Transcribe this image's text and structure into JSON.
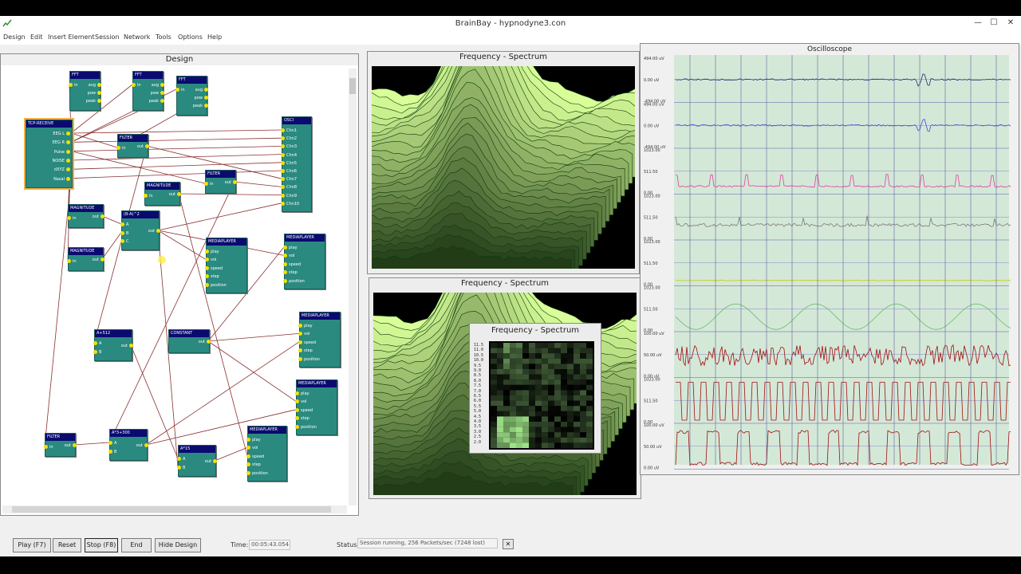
{
  "window": {
    "title": "BrainBay - hypnodyne3.con",
    "minimize": "—",
    "maximize": "☐",
    "close": "✕"
  },
  "menu": [
    "Design",
    "Edit",
    "Insert Element",
    "Session",
    "Network",
    "Tools",
    "Options",
    "Help"
  ],
  "design": {
    "title": "Design",
    "nodes": [
      {
        "id": "fft1",
        "title": "FFT",
        "ports": [
          "in",
          "avg",
          "pow",
          "peak"
        ]
      },
      {
        "id": "fft2",
        "title": "FFT",
        "ports": [
          "in",
          "avg",
          "pow",
          "peak"
        ]
      },
      {
        "id": "fft3",
        "title": "FFT",
        "ports": [
          "in",
          "avg",
          "pow",
          "peak"
        ]
      },
      {
        "id": "tcp",
        "title": "TCP-RECEIVE",
        "ports": [
          "EEG L",
          "EEG R",
          "Pulse",
          "NOISE",
          "dXYZ",
          "Nasal"
        ]
      },
      {
        "id": "filter1",
        "title": "FILTER",
        "ports": [
          "in",
          "out"
        ]
      },
      {
        "id": "osci",
        "title": "OSCI",
        "ports": [
          "Chn1",
          "Chn2",
          "Chn3",
          "Chn4",
          "Chn5",
          "Chn6",
          "Chn7",
          "Chn8",
          "Chn9",
          "Chn10"
        ]
      },
      {
        "id": "mag1",
        "title": "MAGNITUDE",
        "ports": [
          "in",
          "out"
        ]
      },
      {
        "id": "filter2",
        "title": "FILTER",
        "ports": [
          "in",
          "out"
        ]
      },
      {
        "id": "mag2",
        "title": "MAGNITUDE",
        "ports": [
          "in",
          "out"
        ]
      },
      {
        "id": "bma",
        "title": "(B-A)^2",
        "ports": [
          "A",
          "B",
          "C",
          "out"
        ]
      },
      {
        "id": "mag3",
        "title": "MAGNITUDE",
        "ports": [
          "in",
          "out"
        ]
      },
      {
        "id": "mp1",
        "title": "MEDIAPLAYER",
        "ports": [
          "play",
          "vol",
          "speed",
          "step",
          "position"
        ]
      },
      {
        "id": "mp2",
        "title": "MEDIAPLAYER",
        "ports": [
          "play",
          "vol",
          "speed",
          "step",
          "position"
        ]
      },
      {
        "id": "a512",
        "title": "A+512",
        "ports": [
          "A",
          "B",
          "out"
        ]
      },
      {
        "id": "const",
        "title": "CONSTANT",
        "ports": [
          "out"
        ]
      },
      {
        "id": "mp3",
        "title": "MEDIAPLAYER",
        "ports": [
          "play",
          "vol",
          "speed",
          "step",
          "position"
        ]
      },
      {
        "id": "mp4",
        "title": "MEDIAPLAYER",
        "ports": [
          "play",
          "vol",
          "speed",
          "step",
          "position"
        ]
      },
      {
        "id": "filter3",
        "title": "FILTER",
        "ports": [
          "in",
          "out"
        ]
      },
      {
        "id": "a3300",
        "title": "A*3+300",
        "ports": [
          "A",
          "B",
          "out"
        ]
      },
      {
        "id": "mp5",
        "title": "MEDIAPLAYER",
        "ports": [
          "play",
          "vol",
          "speed",
          "step",
          "position"
        ]
      },
      {
        "id": "a15",
        "title": "A*15",
        "ports": [
          "A",
          "B",
          "out"
        ]
      }
    ]
  },
  "spectrum1": {
    "title": "Frequency - Spectrum"
  },
  "spectrum2": {
    "title": "Frequency - Spectrum"
  },
  "spectrum3": {
    "title": "Frequency - Spectrum",
    "scale": [
      "11.5",
      "11.0",
      "10.5",
      "10.0",
      "9.5",
      "9.0",
      "8.5",
      "8.0",
      "7.5",
      "7.0",
      "6.5",
      "6.0",
      "5.5",
      "5.0",
      "4.5",
      "4.0",
      "3.5",
      "3.0",
      "2.5",
      "2.0"
    ]
  },
  "oscilloscope": {
    "title": "Oscilloscope",
    "channels": [
      {
        "labels": [
          "494.00 uV",
          "0.00 uV",
          "-494.00 uV"
        ],
        "color": "#2a2a70"
      },
      {
        "labels": [
          "494.00 uV",
          "0.00 uV",
          "-494.00 uV"
        ],
        "color": "#4a4ad0"
      },
      {
        "labels": [
          "1023.00",
          "511.50",
          "0.00"
        ],
        "color": "#e040a0"
      },
      {
        "labels": [
          "1023.00",
          "511.50",
          "0.00"
        ],
        "color": "#7a7a7a"
      },
      {
        "labels": [
          "1023.00",
          "511.50",
          "0.00"
        ],
        "color": "#c8c800"
      },
      {
        "labels": [
          "1023.00",
          "511.50",
          "0.00"
        ],
        "color": "#60c060"
      },
      {
        "labels": [
          "100.00 uV",
          "50.00 uV",
          "0.00 uV"
        ],
        "color": "#a01010"
      },
      {
        "labels": [
          "1023.00",
          "511.50",
          "0.00"
        ],
        "color": "#a01010"
      },
      {
        "labels": [
          "100.00 uV",
          "50.00 uV",
          "0.00 uV"
        ],
        "color": "#a01010"
      }
    ]
  },
  "bottom": {
    "play": "Play (F7)",
    "reset": "Reset",
    "stop": "Stop (F8)",
    "end": "End",
    "hide": "Hide Design",
    "time_label": "Time:",
    "time_value": "00:05:43.054",
    "status_label": "Status:",
    "status_value": "Session running,  256 Packets/sec (7248 lost)",
    "close": "✕"
  },
  "colors": {
    "node": "#2a8a80",
    "node_header": "#0a0a70",
    "port": "#f3e000",
    "wire": "#8a2a2a",
    "scope_bg": "#d4e8d8"
  }
}
